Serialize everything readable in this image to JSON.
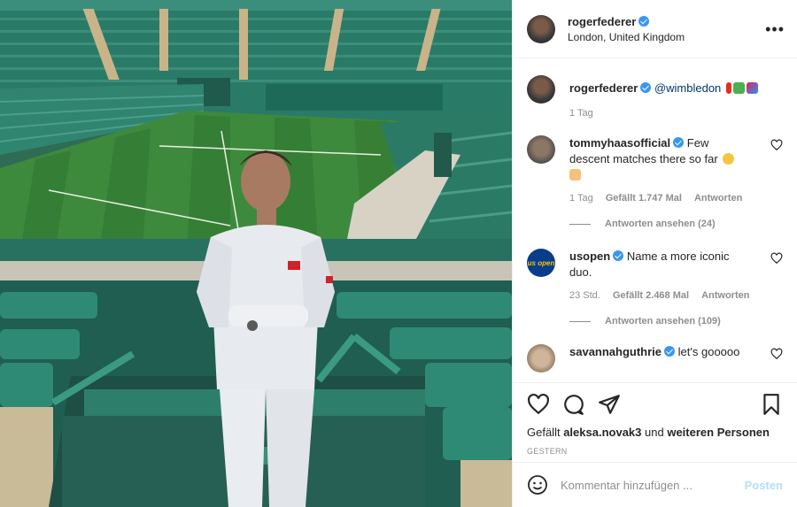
{
  "header": {
    "username": "rogerfederer",
    "location": "London, United Kingdom",
    "more_label": "•••"
  },
  "caption": {
    "username": "rogerfederer",
    "mention": "@wimbledon",
    "emojis": [
      "red-pin",
      "green-plant",
      "colored-flag"
    ],
    "time": "1 Tag"
  },
  "comments": [
    {
      "username": "tommyhaasofficial",
      "text_line1": "Few",
      "text_line2": "descent matches there so far",
      "time": "1 Tag",
      "likes": "Gefällt 1.747 Mal",
      "reply": "Antworten",
      "view_replies": "Antworten ansehen (24)"
    },
    {
      "username": "usopen",
      "avatar_text": "us open",
      "text_line1": "Name a more iconic",
      "text_line2": "duo.",
      "time": "23 Std.",
      "likes": "Gefällt 2.468 Mal",
      "reply": "Antworten",
      "view_replies": "Antworten ansehen (109)"
    },
    {
      "username": "savannahguthrie",
      "text": "let's gooooo"
    }
  ],
  "actions": {
    "liked_by_prefix": "Gefällt",
    "liked_by_user": "aleksa.novak3",
    "liked_by_connector": "und",
    "liked_by_rest": "weiteren Personen",
    "timestamp": "GESTERN"
  },
  "composer": {
    "placeholder": "Kommentar hinzufügen ...",
    "post_label": "Posten"
  },
  "colors": {
    "accent": "#3897f0",
    "post_disabled": "#b2dffc",
    "court_green": "#3c8a3c",
    "seats_green": "#2a7a63"
  }
}
